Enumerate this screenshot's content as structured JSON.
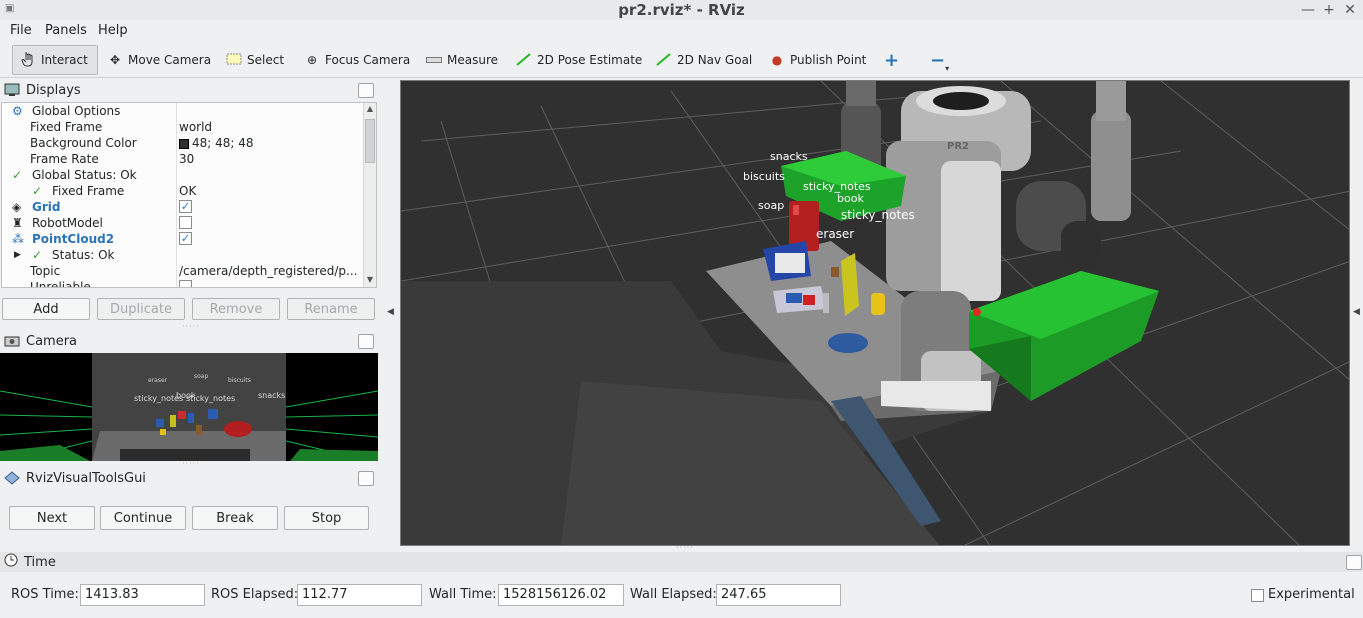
{
  "window": {
    "title": "pr2.rviz* - RViz"
  },
  "menu": {
    "file": "File",
    "panels": "Panels",
    "help": "Help"
  },
  "toolbar": {
    "interact": "Interact",
    "move_camera": "Move Camera",
    "select": "Select",
    "focus_camera": "Focus Camera",
    "measure": "Measure",
    "pose_estimate": "2D Pose Estimate",
    "nav_goal": "2D Nav Goal",
    "publish_point": "Publish Point",
    "add_glyph": "+",
    "remove_glyph": "−"
  },
  "displays": {
    "title": "Displays",
    "rows": [
      {
        "key": "Global Options",
        "value": ""
      },
      {
        "key": "Fixed Frame",
        "value": "world"
      },
      {
        "key": "Background Color",
        "value": "48; 48; 48"
      },
      {
        "key": "Frame Rate",
        "value": "30"
      },
      {
        "key": "Global Status: Ok",
        "value": ""
      },
      {
        "key": "Fixed Frame",
        "value": "OK"
      },
      {
        "key": "Grid",
        "value": ""
      },
      {
        "key": "RobotModel",
        "value": ""
      },
      {
        "key": "PointCloud2",
        "value": ""
      },
      {
        "key": "Status: Ok",
        "value": ""
      },
      {
        "key": "Topic",
        "value": "/camera/depth_registered/p..."
      },
      {
        "key": "Unreliable",
        "value": ""
      }
    ],
    "checked": {
      "grid": true,
      "robot_model": false,
      "point_cloud2": true,
      "unreliable": false
    },
    "background_color_hex": "#303030",
    "buttons": {
      "add": "Add",
      "duplicate": "Duplicate",
      "remove": "Remove",
      "rename": "Rename"
    }
  },
  "camera_panel": {
    "title": "Camera",
    "overlay_labels": [
      "eraser",
      "soap",
      "biscuits",
      "sticky_notes",
      "book",
      "sticky_notes",
      "snacks"
    ]
  },
  "rviz_tools": {
    "title": "RvizVisualToolsGui",
    "buttons": {
      "next": "Next",
      "continue": "Continue",
      "break": "Break",
      "stop": "Stop"
    }
  },
  "scene_labels": {
    "snacks": "snacks",
    "biscuits": "biscuits",
    "sticky_notes_1": "sticky_notes",
    "book": "book",
    "soap": "soap",
    "sticky_notes_2": "sticky_notes",
    "eraser": "eraser",
    "robot_badge": "PR2"
  },
  "time": {
    "title": "Time",
    "ros_time_label": "ROS Time:",
    "ros_time": "1413.83",
    "ros_elapsed_label": "ROS Elapsed:",
    "ros_elapsed": "112.77",
    "wall_time_label": "Wall Time:",
    "wall_time": "1528156126.02",
    "wall_elapsed_label": "Wall Elapsed:",
    "wall_elapsed": "247.65",
    "experimental_label": "Experimental",
    "experimental_checked": false
  },
  "colors": {
    "accent_blue": "#2a75b8",
    "ok_green": "#3b9a3b",
    "bin_green": "#1fa52a",
    "view_bg": "#303030"
  }
}
